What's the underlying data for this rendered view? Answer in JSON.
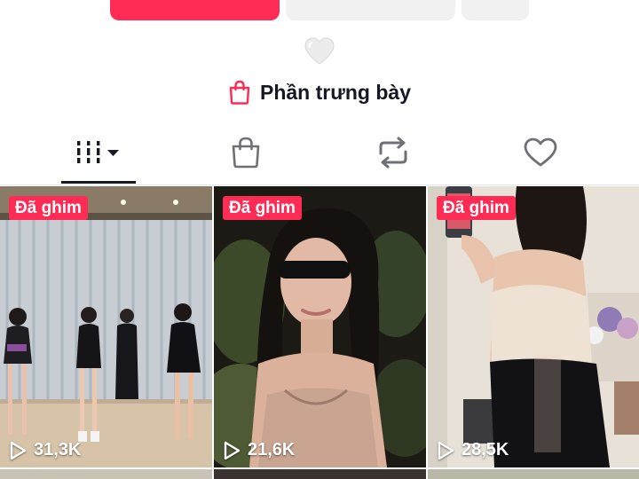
{
  "profile_actions": {
    "follow_color": "#fe2c55",
    "secondary_color": "#f1f1f2"
  },
  "bio_emoji": "white-heart",
  "showcase": {
    "icon": "shopping-bag-icon",
    "label": "Phần trưng bày"
  },
  "tabs": [
    {
      "id": "videos",
      "icon": "grid-icon",
      "active": true
    },
    {
      "id": "shop",
      "icon": "shopping-bag-icon",
      "active": false
    },
    {
      "id": "reposts",
      "icon": "repost-icon",
      "active": false
    },
    {
      "id": "liked",
      "icon": "heart-outline-icon",
      "active": false
    }
  ],
  "videos": [
    {
      "badge": "Đã ghim",
      "views": "31,3K"
    },
    {
      "badge": "Đã ghim",
      "views": "21,6K"
    },
    {
      "badge": "Đã ghim",
      "views": "28,5K"
    }
  ],
  "colors": {
    "accent": "#fe2c55",
    "text": "#161823"
  }
}
